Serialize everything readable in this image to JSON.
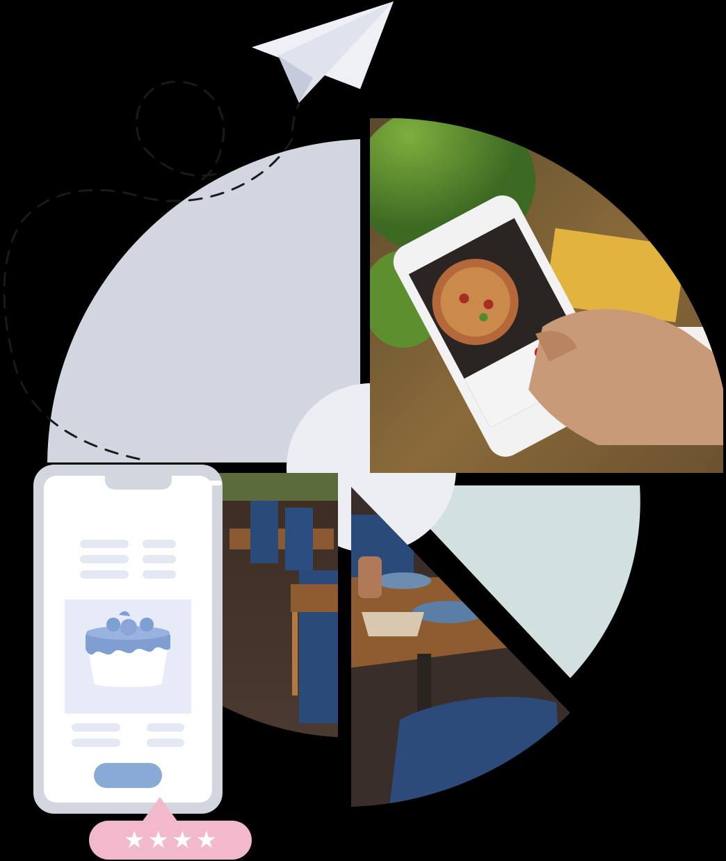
{
  "colors": {
    "background": "#000000",
    "quarter_gray": "#d2d6e1",
    "quarter_mint": "#d2e0df",
    "center_disc": "#edeef3",
    "paper_plane": "#eef0f6",
    "dashed_path": "#1a1a1a",
    "phone_frame": "#d2d6de",
    "cta_button": "#8aaad6",
    "rating_bubble": "#f2b8cb"
  },
  "rating": {
    "stars": 4,
    "max": 4
  },
  "icons": [
    "paper-plane-icon",
    "cake-icon",
    "star-icon"
  ],
  "photos": [
    "pizza-app-on-smartphone-photo",
    "restaurant-dining-room-photo"
  ]
}
